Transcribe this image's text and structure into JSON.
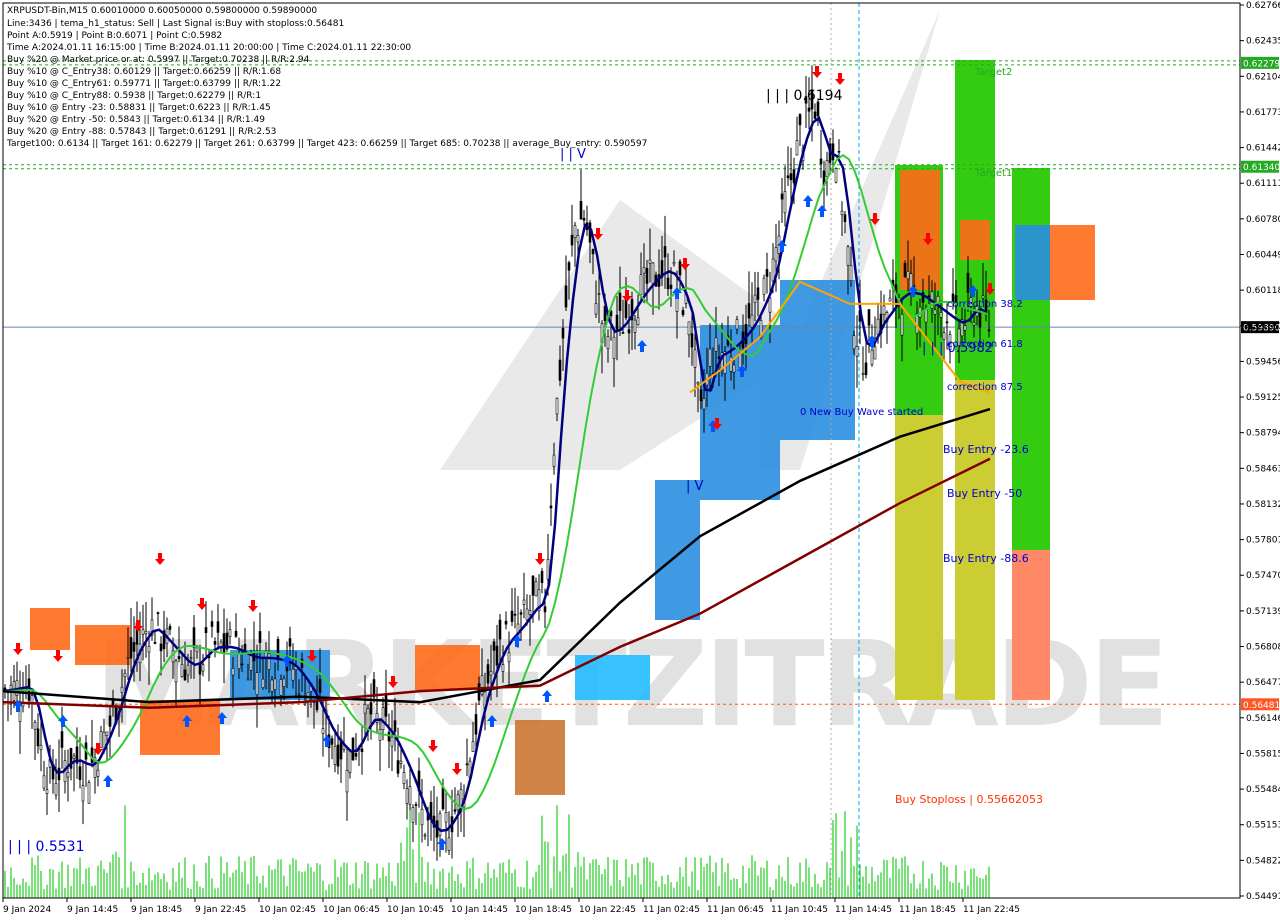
{
  "chart_data": {
    "type": "candlestick",
    "symbol_line": "XRPUSDT-Bin,M15  0.60010000 0.60050000 0.59800000 0.59890000",
    "info_lines": [
      "Line:3436 | tema_h1_status: Sell | Last Signal is:Buy with stoploss:0.56481",
      "Point A:0.5919 | Point B:0.6071 | Point C:0.5982",
      "Time A:2024.01.11 16:15:00 | Time B:2024.01.11 20:00:00 | Time C:2024.01.11 22:30:00",
      "Buy %20 @ Market price or at: 0.5997 || Target:0.70238 || R/R:2.94",
      "Buy %10 @ C_Entry38: 0.60129 || Target:0.66259 || R/R:1.68",
      "Buy %10 @ C_Entry61: 0.59771 || Target:0.63799 || R/R:1.22",
      "Buy %10 @ C_Entry88: 0.5938 || Target:0.62279 || R/R:1",
      "Buy %10 @ Entry -23: 0.58831 || Target:0.6223 || R/R:1.45",
      "Buy %20 @ Entry -50: 0.5843 || Target:0.6134 || R/R:1.49",
      "Buy %20 @ Entry -88: 0.57843 || Target:0.61291 || R/R:2.53",
      "Target100: 0.6134 || Target 161: 0.62279 || Target 261: 0.63799 || Target 423: 0.66259 || Target 685: 0.70238 || average_Buy_entry: 0.590597"
    ],
    "y_ticks": [
      "0.62766",
      "0.62435",
      "0.62104",
      "0.61773",
      "0.61442",
      "0.61111",
      "0.60780",
      "0.60449",
      "0.60118",
      "0.59787",
      "0.59456",
      "0.59125",
      "0.58794",
      "0.58463",
      "0.58132",
      "0.57801",
      "0.57470",
      "0.57139",
      "0.56808",
      "0.56477",
      "0.56146",
      "0.55815",
      "0.55484",
      "0.55153",
      "0.54822",
      "0.54491"
    ],
    "y_ticks_shown": [
      "0.62766",
      "0.62435",
      "0.62104",
      "0.61773",
      "0.61442",
      "0.61111",
      "0.60780",
      "0.60449",
      "0.60118",
      "0.59787",
      "0.59456",
      "0.59125",
      "0.58794",
      "0.58463",
      "0.58132",
      "0.57801",
      "0.57470",
      "0.57139",
      "0.56808",
      "0.56477",
      "0.56146",
      "0.55815",
      "0.55484",
      "0.55153",
      "0.54822",
      "0.54491"
    ],
    "y_axis_labels": [
      "0.62766",
      "0.62435",
      "0.62104",
      "0.61773",
      "0.61442",
      "0.61111",
      "0.60780",
      "0.60449",
      "0.60118",
      "0.59787",
      "0.59456",
      "0.59125",
      "0.58794",
      "0.58463",
      "0.58132",
      "0.57801",
      "0.57470",
      "0.57139",
      "0.56808",
      "0.56477",
      "0.56146",
      "0.55815",
      "0.55484",
      "0.55153",
      "0.54822",
      "0.54491"
    ],
    "y_labels_printed": [
      "0.62766",
      "0.62435",
      "0.62104",
      "0.61773",
      "0.61442",
      "0.61111",
      "0.60780",
      "0.60449",
      "0.60118",
      "0.59787",
      "0.59456",
      "0.59125",
      "0.58794",
      "0.58463",
      "0.58132",
      "0.57801",
      "0.57470",
      "0.57139",
      "0.56808",
      "0.56477",
      "0.56146",
      "0.55815",
      "0.55484",
      "0.55153",
      "0.54822",
      "0.54491"
    ],
    "x_tick_labels": [
      "9 Jan 2024",
      "9 Jan 14:45",
      "9 Jan 18:45",
      "9 Jan 22:45",
      "10 Jan 02:45",
      "10 Jan 06:45",
      "10 Jan 10:45",
      "10 Jan 14:45",
      "10 Jan 18:45",
      "10 Jan 22:45",
      "11 Jan 02:45",
      "11 Jan 06:45",
      "11 Jan 10:45",
      "11 Jan 14:45",
      "11 Jan 18:45",
      "11 Jan 22:45"
    ],
    "ylim": [
      0.5473,
      0.6282
    ],
    "price_tags": [
      {
        "value": 0.62279,
        "label": "0.62279",
        "bg": "#22aa22"
      },
      {
        "value": 0.6134,
        "label": "0.61340",
        "bg": "#22aa22"
      },
      {
        "value": 0.5989,
        "label": "0.59890",
        "bg": "#000000"
      },
      {
        "value": 0.56481,
        "label": "0.56481",
        "bg": "#ff5522"
      }
    ],
    "annotations": [
      {
        "text": "| | | 0.6194",
        "color": "#000000"
      },
      {
        "text": "| | | 0.5531",
        "color": "#0000cc"
      },
      {
        "text": "| | | 0.5982",
        "color": "#0000cc"
      },
      {
        "text": "| V",
        "color": "#0000cc"
      },
      {
        "text": "| | V",
        "color": "#0000cc"
      },
      {
        "text": "0 New Buy Wave started",
        "color": "#0000cc"
      },
      {
        "text": "correction 38.2",
        "color": "#0000cc"
      },
      {
        "text": "correction 61.8",
        "color": "#0000cc"
      },
      {
        "text": "correction 87.5",
        "color": "#0000cc"
      },
      {
        "text": "Buy Entry -23.6",
        "color": "#0000cc"
      },
      {
        "text": "Buy Entry -50",
        "color": "#0000cc"
      },
      {
        "text": "Buy Entry -88.6",
        "color": "#0000cc"
      },
      {
        "text": "Buy Stoploss | 0.55662053",
        "color": "#ff3300"
      },
      {
        "text": "Target2",
        "color": "#22aa22"
      },
      {
        "text": "Target1",
        "color": "#22aa22"
      }
    ],
    "watermark": "MARKETZITRADE",
    "colors": {
      "tema": "#000080",
      "ma_green": "#33cc33",
      "ma_black": "#000000",
      "ma_darkred": "#800000",
      "ma_orange": "#ffa500",
      "cloud_blue": "#2a8ee0",
      "cloud_orange": "#ff6a1a",
      "zone_green": "#33cc11",
      "zone_yellow": "#cccc33",
      "zone_salmon": "#ff8866",
      "volume": "#22cc22",
      "arrow_up": "#0055ff",
      "arrow_down": "#ff0000",
      "vline": "#00aaee"
    }
  }
}
